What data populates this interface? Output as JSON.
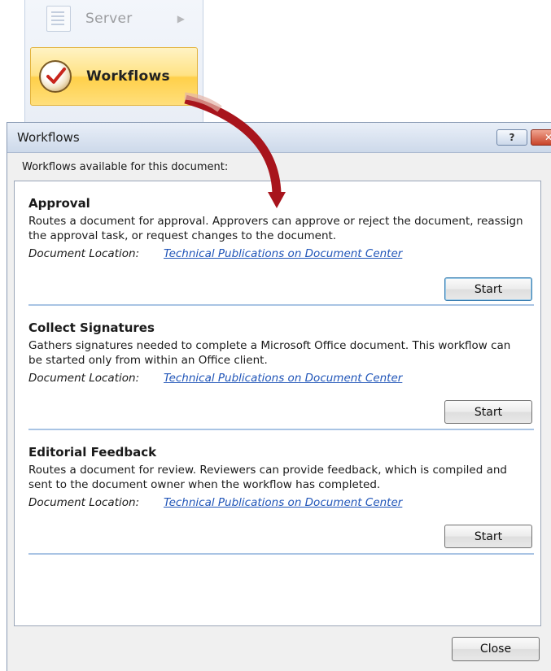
{
  "menu": {
    "server_label": "Server",
    "workflows_label": "Workflows"
  },
  "dialog": {
    "title": "Workflows",
    "help_symbol": "?",
    "close_symbol": "✕",
    "subtitle": "Workflows available for this document:",
    "workflows": [
      {
        "name": "Approval",
        "description": "Routes a document for approval. Approvers can approve or reject the document, reassign the approval task, or request changes to the document.",
        "location_label": "Document Location:",
        "location_link": "Technical Publications on Document Center",
        "start_label": "Start"
      },
      {
        "name": "Collect Signatures",
        "description": "Gathers signatures needed to complete a Microsoft Office document. This workflow can be started only from within an Office client.",
        "location_label": "Document Location:",
        "location_link": "Technical Publications on Document Center",
        "start_label": "Start"
      },
      {
        "name": "Editorial Feedback",
        "description": "Routes a document for review. Reviewers can provide feedback, which is compiled and sent to the document owner when the workflow has completed.",
        "location_label": "Document Location:",
        "location_link": "Technical Publications on Document Center",
        "start_label": "Start"
      }
    ],
    "close_label": "Close"
  },
  "colors": {
    "arrow": "#a8141c",
    "link": "#2055b8",
    "separator": "#a9c4e4",
    "menu_highlight": "#ffd04a"
  }
}
